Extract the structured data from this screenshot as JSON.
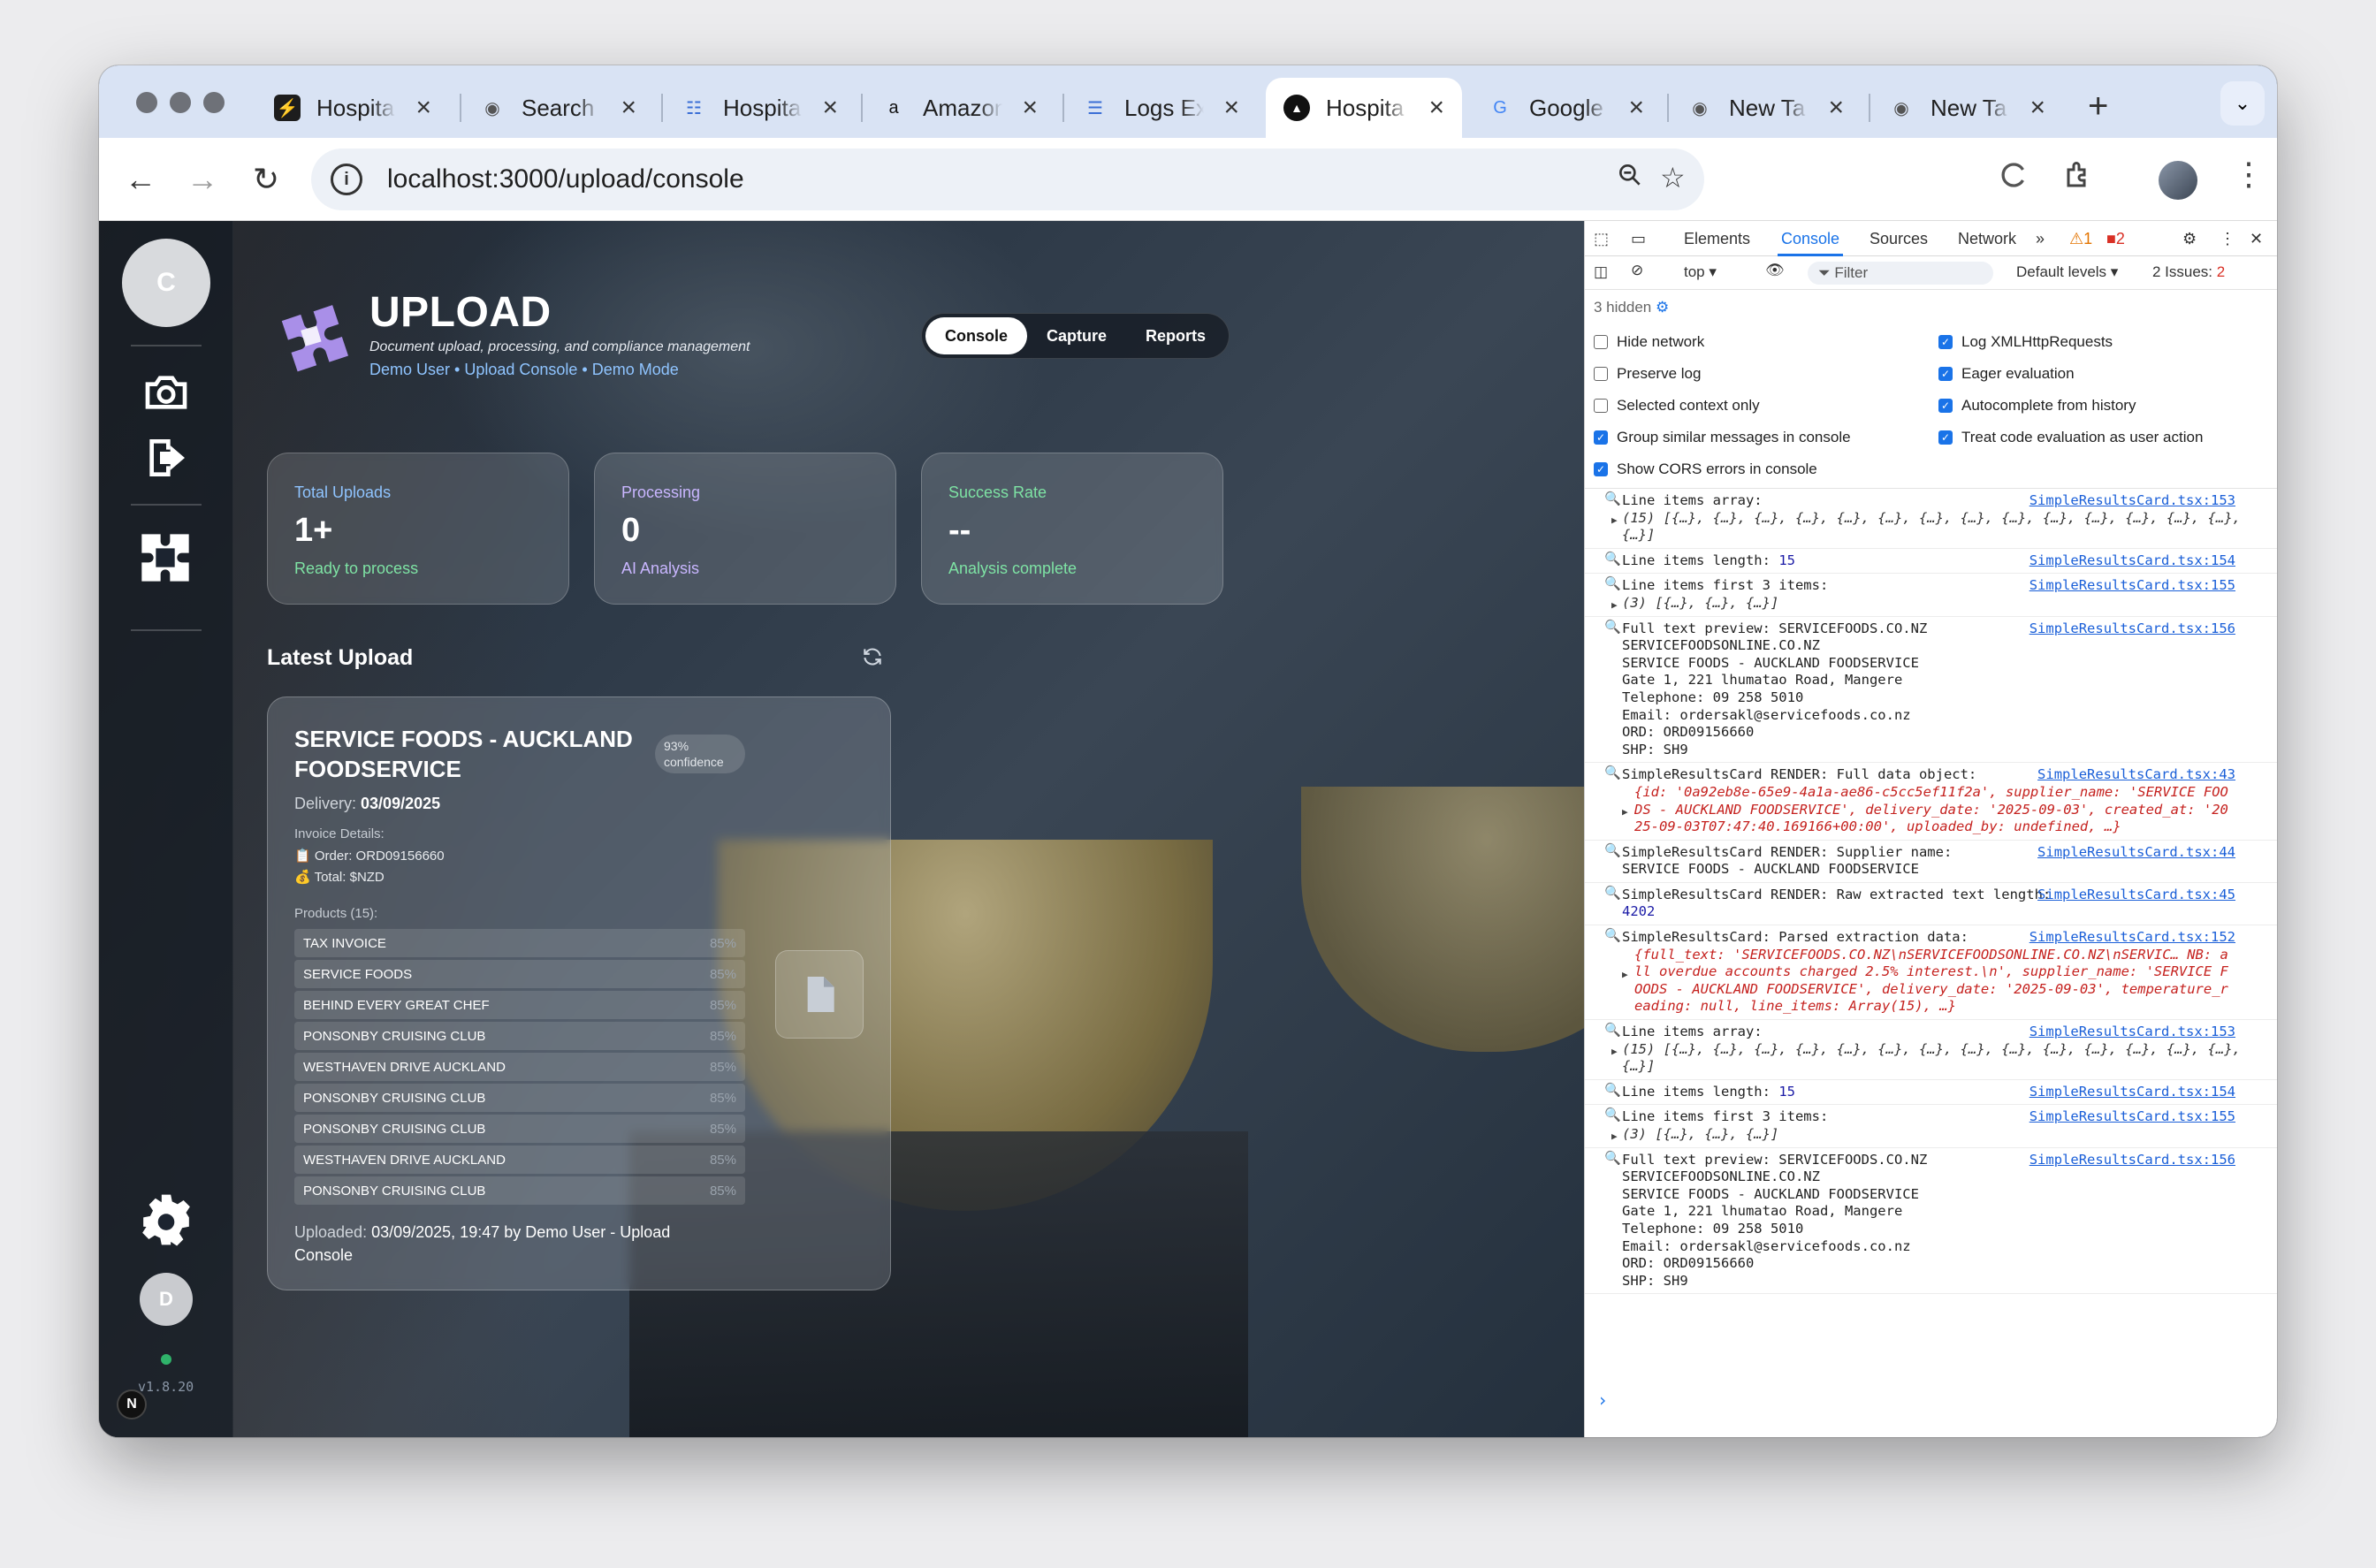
{
  "browser": {
    "tabs": [
      {
        "title": "Hospita",
        "icon": "bolt-icon"
      },
      {
        "title": "Search",
        "icon": "chrome-icon"
      },
      {
        "title": "Hospita",
        "icon": "doc-icon"
      },
      {
        "title": "Amazon",
        "icon": "amazon-icon"
      },
      {
        "title": "Logs Ex",
        "icon": "list-icon"
      },
      {
        "title": "Hospita",
        "icon": "triangle-icon"
      },
      {
        "title": "Google",
        "icon": "google-icon"
      },
      {
        "title": "New Ta",
        "icon": "chrome-icon"
      },
      {
        "title": "New Ta",
        "icon": "chrome-icon"
      }
    ],
    "active_tab": 5,
    "url": "localhost:3000/upload/console"
  },
  "sidebar": {
    "user_initial": "C",
    "bottom_initial": "D",
    "version": "v1.8.20",
    "badge": "N"
  },
  "header": {
    "title": "UPLOAD",
    "subtitle": "Document upload, processing, and compliance management",
    "breadcrumb": "Demo User • Upload Console • Demo Mode",
    "tabs": [
      "Console",
      "Capture",
      "Reports"
    ]
  },
  "stats": [
    {
      "label": "Total Uploads",
      "value": "1+",
      "sub": "Ready to process",
      "label_color": "#8fc4ff",
      "sub_color": "#7ee3a4"
    },
    {
      "label": "Processing",
      "value": "0",
      "sub": "AI Analysis",
      "label_color": "#c9b6ff",
      "sub_color": "#c9b6ff"
    },
    {
      "label": "Success Rate",
      "value": "--",
      "sub": "Analysis complete",
      "label_color": "#7ee3a4",
      "sub_color": "#7ee3a4"
    }
  ],
  "latest": {
    "heading": "Latest Upload",
    "supplier": "SERVICE FOODS - AUCKLAND FOODSERVICE",
    "confidence": "93% confidence",
    "delivery_label": "Delivery:",
    "delivery_date": "03/09/2025",
    "invoice_details_label": "Invoice Details:",
    "order": "Order: ORD09156660",
    "total": "Total: $NZD",
    "products_label": "Products (15):",
    "products": [
      {
        "name": "TAX INVOICE",
        "pct": "85%"
      },
      {
        "name": "SERVICE FOODS",
        "pct": "85%"
      },
      {
        "name": "BEHIND EVERY GREAT CHEF",
        "pct": "85%"
      },
      {
        "name": "PONSONBY CRUISING CLUB",
        "pct": "85%"
      },
      {
        "name": "WESTHAVEN DRIVE AUCKLAND",
        "pct": "85%"
      },
      {
        "name": "PONSONBY CRUISING CLUB",
        "pct": "85%"
      },
      {
        "name": "PONSONBY CRUISING CLUB",
        "pct": "85%"
      },
      {
        "name": "WESTHAVEN DRIVE AUCKLAND",
        "pct": "85%"
      },
      {
        "name": "PONSONBY CRUISING CLUB",
        "pct": "85%"
      }
    ],
    "uploaded_prefix": "Uploaded:",
    "uploaded_value": "03/09/2025, 19:47 by Demo User - Upload Console"
  },
  "devtools": {
    "tabs": [
      "Elements",
      "Console",
      "Sources",
      "Network"
    ],
    "warn_count": "1",
    "err_count": "2",
    "context": "top",
    "filter_placeholder": "Filter",
    "levels": "Default levels",
    "issues": "2 Issues:",
    "issues_count": "2",
    "hidden": "3 hidden",
    "options_left": [
      {
        "label": "Hide network",
        "checked": false
      },
      {
        "label": "Preserve log",
        "checked": false
      },
      {
        "label": "Selected context only",
        "checked": false
      },
      {
        "label": "Group similar messages in console",
        "checked": true
      },
      {
        "label": "Show CORS errors in console",
        "checked": true
      }
    ],
    "options_right": [
      {
        "label": "Log XMLHttpRequests",
        "checked": true
      },
      {
        "label": "Eager evaluation",
        "checked": true
      },
      {
        "label": "Autocomplete from history",
        "checked": true
      },
      {
        "label": "Treat code evaluation as user action",
        "checked": true
      }
    ],
    "logs": [
      {
        "msg": "Line items array:",
        "expand": "(15) [{…}, {…}, {…}, {…}, {…}, {…}, {…}, {…}, {…}, {…}, {…}, {…}, {…}, {…}, {…}]",
        "src": "SimpleResultsCard.tsx:153"
      },
      {
        "msg": "Line items length: ",
        "num": "15",
        "src": "SimpleResultsCard.tsx:154"
      },
      {
        "msg": "Line items first 3 items:",
        "expand": "(3) [{…}, {…}, {…}]",
        "src": "SimpleResultsCard.tsx:155"
      },
      {
        "msg": "Full text preview: SERVICEFOODS.CO.NZ\nSERVICEFOODSONLINE.CO.NZ\nSERVICE FOODS - AUCKLAND FOODSERVICE\nGate 1, 221 lhumatao Road, Mangere\nTelephone: 09 258 5010\nEmail: ordersakl@servicefoods.co.nz\nORD: ORD09156660\nSHP: SH9",
        "src": "SimpleResultsCard.tsx:156"
      },
      {
        "msg": "SimpleResultsCard RENDER: Full data object:",
        "obj": "{id: '0a92eb8e-65e9-4a1a-ae86-c5cc5ef11f2a', supplier_name: 'SERVICE FOODS - AUCKLAND FOODSERVICE', delivery_date: '2025-09-03', created_at: '2025-09-03T07:47:40.169166+00:00', uploaded_by: undefined, …}",
        "src": "SimpleResultsCard.tsx:43"
      },
      {
        "msg": "SimpleResultsCard RENDER: Supplier name:\nSERVICE FOODS - AUCKLAND FOODSERVICE",
        "src": "SimpleResultsCard.tsx:44"
      },
      {
        "msg": "SimpleResultsCard RENDER: Raw extracted text length: ",
        "num": "4202",
        "src": "SimpleResultsCard.tsx:45"
      },
      {
        "msg": "SimpleResultsCard: Parsed extraction data:",
        "obj": "{full_text: 'SERVICEFOODS.CO.NZ\\nSERVICEFOODSONLINE.CO.NZ\\nSERVIC… NB: all overdue accounts charged 2.5% interest.\\n', supplier_name: 'SERVICE FOODS - AUCKLAND FOODSERVICE', delivery_date: '2025-09-03', temperature_reading: null, line_items: Array(15), …}",
        "src": "SimpleResultsCard.tsx:152"
      },
      {
        "msg": "Line items array:",
        "expand": "(15) [{…}, {…}, {…}, {…}, {…}, {…}, {…}, {…}, {…}, {…}, {…}, {…}, {…}, {…}, {…}]",
        "src": "SimpleResultsCard.tsx:153"
      },
      {
        "msg": "Line items length: ",
        "num": "15",
        "src": "SimpleResultsCard.tsx:154"
      },
      {
        "msg": "Line items first 3 items:",
        "expand": "(3) [{…}, {…}, {…}]",
        "src": "SimpleResultsCard.tsx:155"
      },
      {
        "msg": "Full text preview: SERVICEFOODS.CO.NZ\nSERVICEFOODSONLINE.CO.NZ\nSERVICE FOODS - AUCKLAND FOODSERVICE\nGate 1, 221 lhumatao Road, Mangere\nTelephone: 09 258 5010\nEmail: ordersakl@servicefoods.co.nz\nORD: ORD09156660\nSHP: SH9",
        "src": "SimpleResultsCard.tsx:156"
      }
    ],
    "prompt": "›"
  }
}
